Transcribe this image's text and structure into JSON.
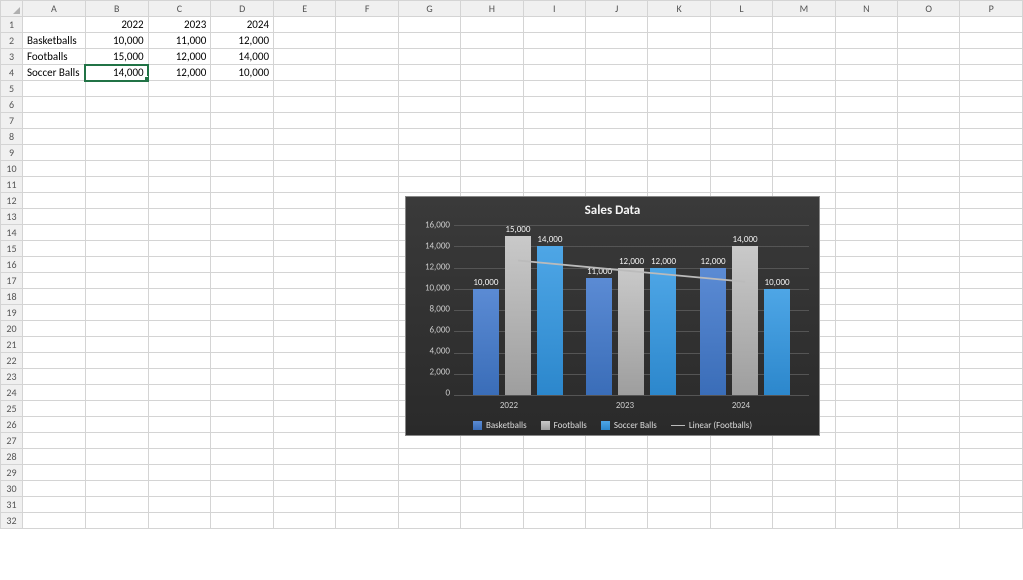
{
  "columns": [
    "A",
    "B",
    "C",
    "D",
    "E",
    "F",
    "G",
    "H",
    "I",
    "J",
    "K",
    "L",
    "M",
    "N",
    "O",
    "P"
  ],
  "rows": 32,
  "table": {
    "headers": [
      "",
      "2022",
      "2023",
      "2024"
    ],
    "data": [
      [
        "Basketballs",
        "10,000",
        "11,000",
        "12,000"
      ],
      [
        "Footballs",
        "15,000",
        "12,000",
        "14,000"
      ],
      [
        "Soccer Balls",
        "14,000",
        "12,000",
        "10,000"
      ]
    ]
  },
  "selected_cell": "B4",
  "chart_data": {
    "type": "bar",
    "title": "Sales Data",
    "categories": [
      "2022",
      "2023",
      "2024"
    ],
    "series": [
      {
        "name": "Basketballs",
        "color": "#3a6db8",
        "values": [
          10000,
          11000,
          12000
        ],
        "labels": [
          "10,000",
          "11,000",
          "12,000"
        ]
      },
      {
        "name": "Footballs",
        "color": "#9e9e9e",
        "values": [
          15000,
          12000,
          14000
        ],
        "labels": [
          "15,000",
          "12,000",
          "14,000"
        ]
      },
      {
        "name": "Soccer Balls",
        "color": "#2c87cc",
        "values": [
          14000,
          12000,
          10000
        ],
        "labels": [
          "14,000",
          "12,000",
          "10,000"
        ]
      }
    ],
    "trendline": {
      "name": "Linear (Footballs)"
    },
    "ylim": [
      0,
      16000
    ],
    "yticks": [
      0,
      2000,
      4000,
      6000,
      8000,
      10000,
      12000,
      14000,
      16000
    ],
    "ytick_labels": [
      "0",
      "2,000",
      "4,000",
      "6,000",
      "8,000",
      "10,000",
      "12,000",
      "14,000",
      "16,000"
    ],
    "legend": [
      "Basketballs",
      "Footballs",
      "Soccer Balls",
      "Linear (Footballs)"
    ]
  }
}
